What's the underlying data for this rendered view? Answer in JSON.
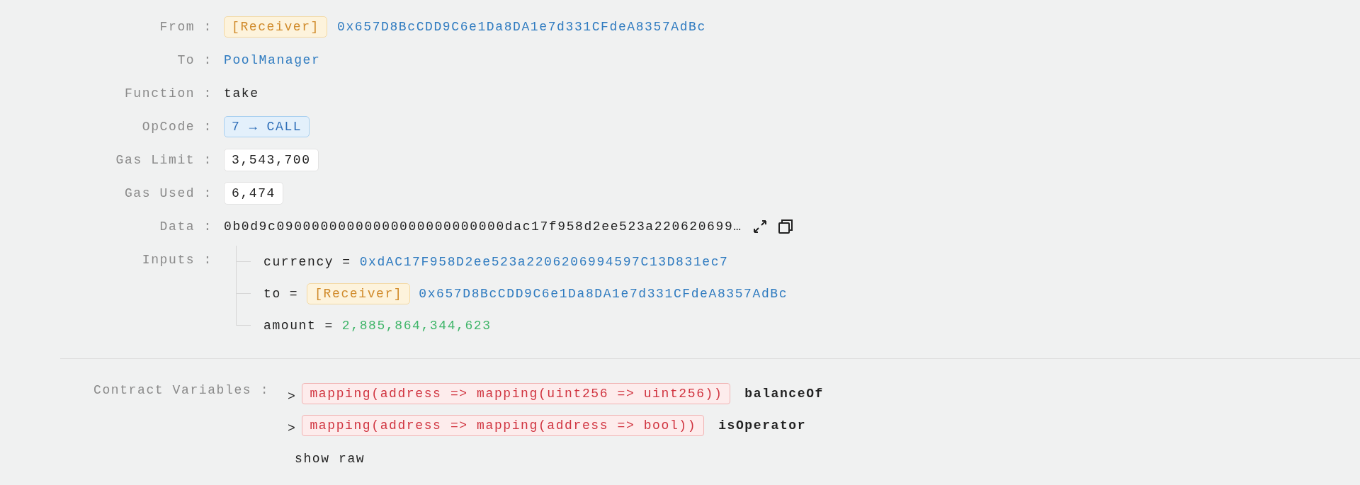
{
  "fields": [
    {
      "label": "From :",
      "kind": "address",
      "tag": "[Receiver]",
      "value": "0x657D8BcCDD9C6e1Da8DA1e7d331CFdeA8357AdBc"
    },
    {
      "label": "To :",
      "kind": "link",
      "value": "PoolManager"
    },
    {
      "label": "Function :",
      "kind": "text",
      "value": "take"
    },
    {
      "label": "OpCode :",
      "kind": "opcode",
      "value": "7 → CALL"
    },
    {
      "label": "Gas Limit :",
      "kind": "boxed",
      "value": "3,543,700"
    },
    {
      "label": "Gas Used :",
      "kind": "boxed",
      "value": "6,474"
    },
    {
      "label": "Data :",
      "kind": "data",
      "value": "0b0d9c09000000000000000000000000dac17f958d2ee523a220620699…"
    },
    {
      "label": "Inputs :",
      "kind": "inputs",
      "inputs": [
        {
          "name": "currency",
          "eq": "=",
          "kind": "address",
          "value": "0xdAC17F958D2ee523a2206206994597C13D831ec7"
        },
        {
          "name": "to",
          "eq": "=",
          "kind": "address",
          "tag": "[Receiver]",
          "value": "0x657D8BcCDD9C6e1Da8DA1e7d331CFdeA8357AdBc"
        },
        {
          "name": "amount",
          "eq": "=",
          "kind": "number",
          "value": "2,885,864,344,623"
        }
      ]
    }
  ],
  "contract_variables": {
    "label": "Contract Variables :",
    "items": [
      {
        "chevron": ">",
        "type": "mapping(address => mapping(uint256 => uint256))",
        "name": "balanceOf"
      },
      {
        "chevron": ">",
        "type": "mapping(address => mapping(address => bool))",
        "name": "isOperator"
      }
    ],
    "show_raw": "show raw"
  }
}
